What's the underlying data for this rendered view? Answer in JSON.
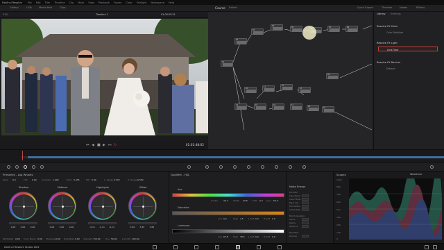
{
  "app": {
    "name": "DaVinci Resolve",
    "version_label": "DaVinci Resolve Studio 18.6"
  },
  "menu": [
    "DaVinci Resolve",
    "File",
    "Edit",
    "Trim",
    "Timeline",
    "Clip",
    "Mark",
    "View",
    "Playback",
    "Fusion",
    "Color",
    "Fairlight",
    "Workspace",
    "Help"
  ],
  "topbar": {
    "left_items": [
      "Gallery",
      "LUTs",
      "Media Pool",
      "Clips"
    ],
    "zoom": "31%",
    "timeline_name": "Timeline 1",
    "timecode": "01:03:25:21",
    "project": "Course",
    "project_state": "Edited",
    "clip_label": "Clip",
    "right_items": [
      "Quick Export",
      "Timeline",
      "Nodes",
      "Effects"
    ]
  },
  "transport": {
    "timecode": "01:01:48:02"
  },
  "library": {
    "tabs": [
      "Library",
      "Settings"
    ],
    "sections": [
      {
        "title": "Resolve FX Color",
        "items": [
          "Color Stabilizer"
        ]
      },
      {
        "title": "Resolve FX Light",
        "items": [
          "Lens Flare"
        ]
      },
      {
        "title": "Resolve FX Revival",
        "items": [
          "Deband"
        ]
      }
    ],
    "selected": "Lens Flare"
  },
  "nodes": [
    {
      "id": "01"
    },
    {
      "id": "02"
    },
    {
      "id": "03"
    },
    {
      "id": "04"
    },
    {
      "id": "05"
    },
    {
      "id": "06"
    },
    {
      "id": "07"
    },
    {
      "id": "08"
    },
    {
      "id": "09"
    },
    {
      "id": "10"
    },
    {
      "id": "11"
    },
    {
      "id": "12"
    },
    {
      "id": "13"
    },
    {
      "id": "14"
    },
    {
      "id": "15"
    },
    {
      "id": "16"
    },
    {
      "id": "17"
    },
    {
      "id": "18"
    },
    {
      "id": "19"
    }
  ],
  "primaries": {
    "title": "Primaries - Log Wheels",
    "temp_label": "Temp",
    "temp": "0.0",
    "tint_label": "Tint",
    "tint": "0.00",
    "contrast_label": "Contrast",
    "contrast": "1.000",
    "pivot_label": "Pivot",
    "pivot": "0.435",
    "mid_label": "MD",
    "mid": "0.00",
    "lrange_label": "L. Range",
    "lrange": "0.333",
    "hrange_label": "H. Range",
    "hrange": "0.550",
    "wheels": [
      {
        "name": "Shadow",
        "values": [
          "0.00",
          "0.00",
          "0.00"
        ]
      },
      {
        "name": "Midtone",
        "values": [
          "0.00",
          "0.00",
          "0.00"
        ]
      },
      {
        "name": "Highlights",
        "values": [
          "-0.11",
          "-0.11",
          "-0.11"
        ]
      },
      {
        "name": "Offset",
        "values": [
          "5.65",
          "5.65",
          "5.65"
        ]
      }
    ],
    "bottom": [
      {
        "label": "Mid/Detail",
        "value": "0.00"
      },
      {
        "label": "Color Boost",
        "value": "0.00"
      },
      {
        "label": "Shadows",
        "value": "0.00"
      },
      {
        "label": "Highlights",
        "value": "0.00"
      },
      {
        "label": "Saturation",
        "value": "50.00"
      },
      {
        "label": "Hue",
        "value": "50.00"
      },
      {
        "label": "Lum Mix",
        "value": "100.00"
      }
    ]
  },
  "qualifier": {
    "title": "Qualifier - HSL",
    "hue_label": "Hue",
    "hue_values": [
      {
        "label": "Center",
        "value": "34.7"
      },
      {
        "label": "Width",
        "value": "43.8"
      },
      {
        "label": "Soft",
        "value": "0.2"
      },
      {
        "label": "Sym",
        "value": "50.0"
      }
    ],
    "sat_label": "Saturation",
    "sat_values": [
      {
        "label": "Low",
        "value": "0.0"
      },
      {
        "label": "High",
        "value": "2.5"
      },
      {
        "label": "L.Soft",
        "value": "0.0"
      },
      {
        "label": "H.Soft",
        "value": "0.0"
      }
    ],
    "lum_label": "Luminance",
    "lum_values": [
      {
        "label": "Low",
        "value": "67.8"
      },
      {
        "label": "High",
        "value": "78.5"
      },
      {
        "label": "L.Soft",
        "value": "0.0"
      },
      {
        "label": "H.Soft",
        "value": "0.0"
      }
    ]
  },
  "matte": {
    "title": "Matte Finesse",
    "rows_a": [
      "Pre-Filter",
      "Clean Black",
      "Clean White",
      "Black Clip",
      "Blur Radius",
      "In/Out Ratio"
    ],
    "rows_b": [
      "Morph Operation",
      "Shrink",
      "Radius",
      "Iterations"
    ],
    "rows_c": [
      "Post Filter",
      "Denoise"
    ]
  },
  "scopes": {
    "title": "Scopes",
    "mode": "Waveform",
    "ticks": [
      "1023",
      "896",
      "768",
      "640",
      "512",
      "384",
      "256",
      "128",
      "0"
    ]
  },
  "colors": {
    "accent_red": "#c2453a",
    "bg": "#1b1b1d",
    "node_line": "#d8d8d8",
    "timeline_blue": "#3f6f9e"
  }
}
